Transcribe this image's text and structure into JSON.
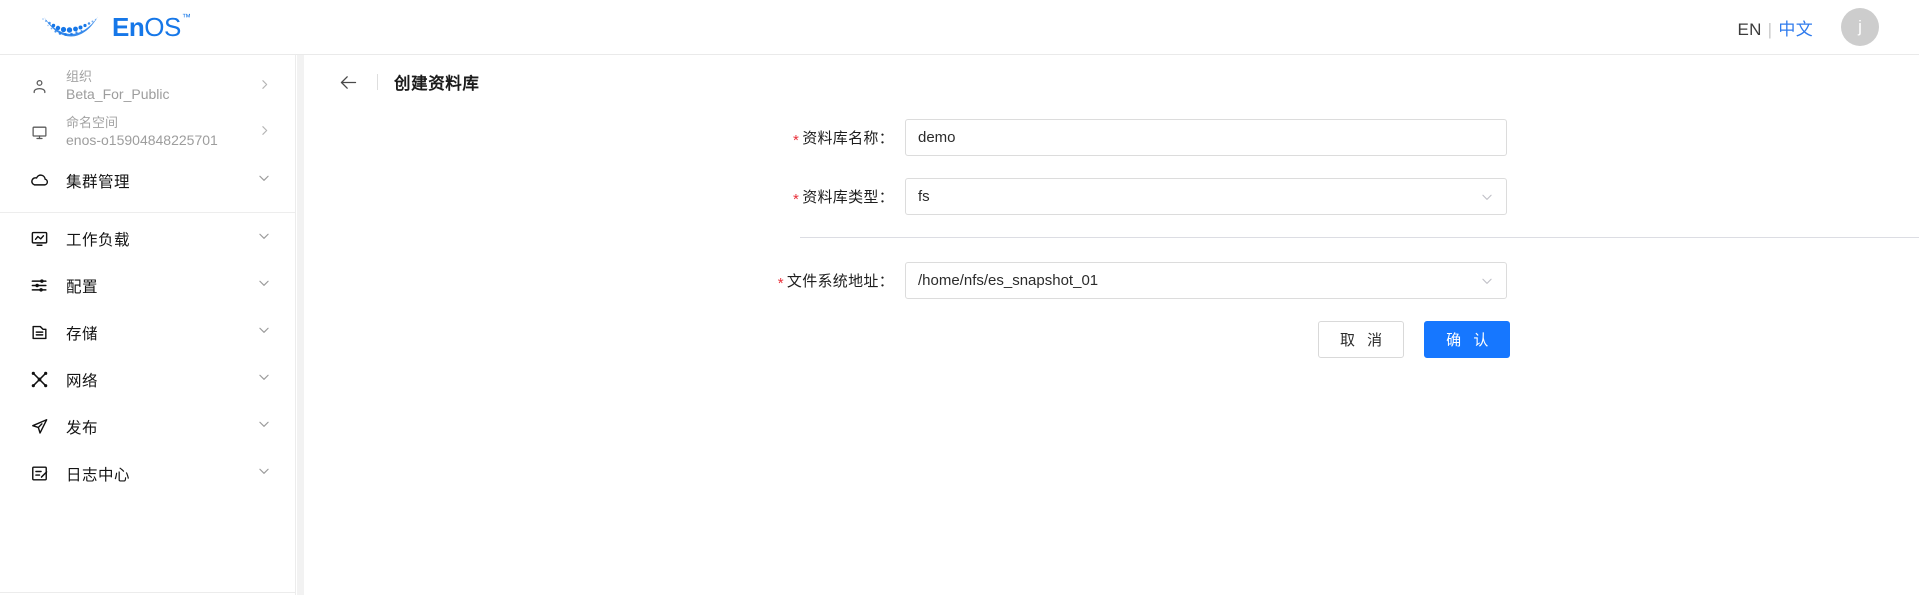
{
  "topbar": {
    "brand": {
      "prefix": "En",
      "suffix": "OS",
      "trademark": "™",
      "icon": "enos-swoosh-logo"
    },
    "language": {
      "en_label": "EN",
      "separator": "|",
      "zh_label": "中文"
    },
    "avatar": {
      "initial": "j"
    }
  },
  "sidebar": {
    "context": [
      {
        "icon": "user-icon",
        "label": "组织",
        "value": "Beta_For_Public",
        "arrow": "›"
      },
      {
        "icon": "monitor-icon",
        "label": "命名空间",
        "value": "enos-o15904848225701",
        "arrow": "›"
      }
    ],
    "menu": [
      {
        "icon": "cloud-icon",
        "label": "集群管理",
        "chevron": "chevron-down-icon"
      },
      {
        "icon": "workload-monitor-icon",
        "label": "工作负载",
        "chevron": "chevron-down-icon"
      },
      {
        "icon": "sliders-icon",
        "label": "配置",
        "chevron": "chevron-down-icon"
      },
      {
        "icon": "storage-folder-icon",
        "label": "存储",
        "chevron": "chevron-down-icon"
      },
      {
        "icon": "network-nodes-icon",
        "label": "网络",
        "chevron": "chevron-down-icon"
      },
      {
        "icon": "send-publish-icon",
        "label": "发布",
        "chevron": "chevron-down-icon"
      },
      {
        "icon": "log-center-icon",
        "label": "日志中心",
        "chevron": "chevron-down-icon"
      }
    ]
  },
  "main": {
    "header": {
      "back_icon": "arrow-left-icon",
      "title": "创建资料库"
    },
    "form": {
      "required_mark": "*",
      "fields": [
        {
          "name": "repository-name",
          "label": "资料库名称：",
          "value": "demo",
          "placeholder": "",
          "type": "text"
        },
        {
          "name": "repository-type",
          "label": "资料库类型：",
          "value": "fs",
          "placeholder": "",
          "type": "select",
          "caret": "chevron-down-icon"
        },
        {
          "name": "filesystem-path",
          "label": "文件系统地址：",
          "value": "/home/nfs/es_snapshot_01",
          "placeholder": "",
          "type": "select",
          "caret": "chevron-down-icon"
        }
      ],
      "buttons": {
        "cancel": "取 消",
        "confirm": "确 认"
      }
    }
  },
  "colors": {
    "brand_blue": "#1677e8",
    "primary_blue": "#1677ff",
    "link_blue": "#2f7bed",
    "required_red": "#e8303a",
    "border_grey": "#dcdcdc",
    "divider_grey": "#dcdde3",
    "avatar_grey": "#cdcdcd"
  }
}
